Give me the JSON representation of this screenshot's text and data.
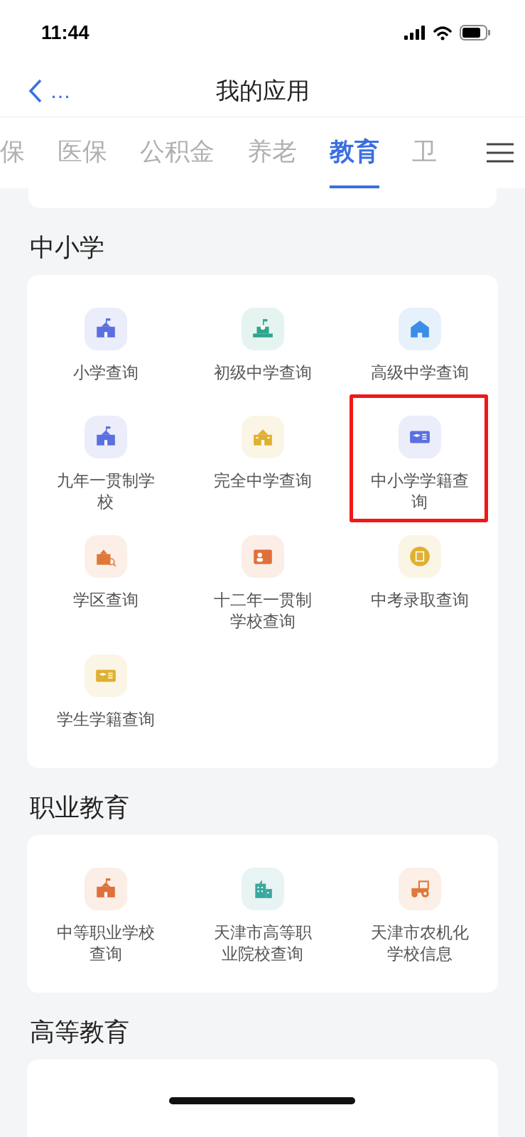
{
  "status_bar": {
    "time": "11:44"
  },
  "nav": {
    "back_label": "…",
    "title": "我的应用"
  },
  "tabs": [
    {
      "label": "保",
      "selected": false
    },
    {
      "label": "医保",
      "selected": false
    },
    {
      "label": "公积金",
      "selected": false
    },
    {
      "label": "养老",
      "selected": false
    },
    {
      "label": "教育",
      "selected": true
    },
    {
      "label": "卫",
      "selected": false
    }
  ],
  "sections": [
    {
      "title": "中小学",
      "apps": [
        {
          "label": "小学查询",
          "kind": "school",
          "color": "#5b6fe0",
          "highlighted": false
        },
        {
          "label": "初级中学查询",
          "kind": "podium",
          "color": "#2fa58e",
          "highlighted": false
        },
        {
          "label": "高级中学查询",
          "kind": "house",
          "color": "#3a8ee8",
          "highlighted": false
        },
        {
          "label": "九年一贯制学校",
          "kind": "school",
          "color": "#5b6fe0",
          "highlighted": false
        },
        {
          "label": "完全中学查询",
          "kind": "building",
          "color": "#e0b030",
          "highlighted": false
        },
        {
          "label": "中小学学籍查询",
          "kind": "card",
          "color": "#5b6fe0",
          "highlighted": true
        },
        {
          "label": "学区查询",
          "kind": "district",
          "color": "#e0783a",
          "highlighted": false
        },
        {
          "label": "十二年一贯制学校查询",
          "kind": "folder",
          "color": "#e0703a",
          "highlighted": false
        },
        {
          "label": "中考录取查询",
          "kind": "coin",
          "color": "#e0b030",
          "highlighted": false
        },
        {
          "label": "学生学籍查询",
          "kind": "card",
          "color": "#e0b030",
          "highlighted": false
        }
      ]
    },
    {
      "title": "职业教育",
      "apps": [
        {
          "label": "中等职业学校查询",
          "kind": "school",
          "color": "#e0703a",
          "highlighted": false
        },
        {
          "label": "天津市高等职业院校查询",
          "kind": "office",
          "color": "#3aa89c",
          "highlighted": false
        },
        {
          "label": "天津市农机化学校信息",
          "kind": "tractor",
          "color": "#e0783a",
          "highlighted": false
        }
      ]
    },
    {
      "title": "高等教育"
    }
  ]
}
